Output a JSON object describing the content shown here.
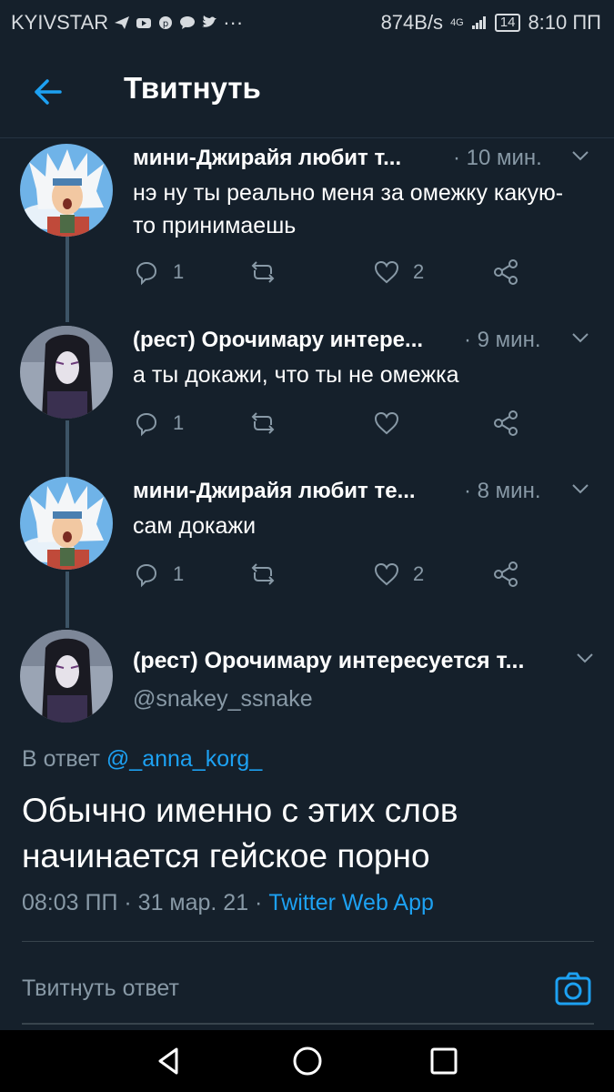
{
  "status_bar": {
    "carrier": "KYIVSTAR",
    "speed": "874B/s",
    "network": "4G",
    "battery": "14",
    "time": "8:10 ПП",
    "more": "···"
  },
  "header": {
    "title": "Твитнуть"
  },
  "thread": [
    {
      "name": "мини-Джирайя любит т...",
      "time": "· 10 мин.",
      "text": "нэ ну ты реально меня за омежку какую-то принимаешь",
      "replies": "1",
      "retweets": "",
      "likes": "2",
      "avatar": "jiraiya"
    },
    {
      "name": "(рест) Орочимару интере...",
      "time": "· 9 мин.",
      "text": "а ты докажи, что ты не омежка",
      "replies": "1",
      "retweets": "",
      "likes": "",
      "avatar": "orochimaru"
    },
    {
      "name": "мини-Джирайя любит те...",
      "time": "· 8 мин.",
      "text": "сам докажи",
      "replies": "1",
      "retweets": "",
      "likes": "2",
      "avatar": "jiraiya"
    }
  ],
  "main_tweet": {
    "name": "(рест) Орочимару интересуется т...",
    "handle": "@snakey_ssnake",
    "reply_prefix": "В ответ ",
    "reply_to": "@_anna_korg_",
    "text": "Обычно именно с этих слов начинается гейское порно",
    "datetime": "08:03 ПП · 31 мар. 21 · ",
    "app": "Twitter Web App"
  },
  "reply_box": {
    "placeholder": "Твитнуть ответ"
  },
  "colors": {
    "background": "#15202b",
    "accent": "#1da1f2",
    "secondary_text": "#8899a6",
    "thread_line": "#3d5466"
  }
}
